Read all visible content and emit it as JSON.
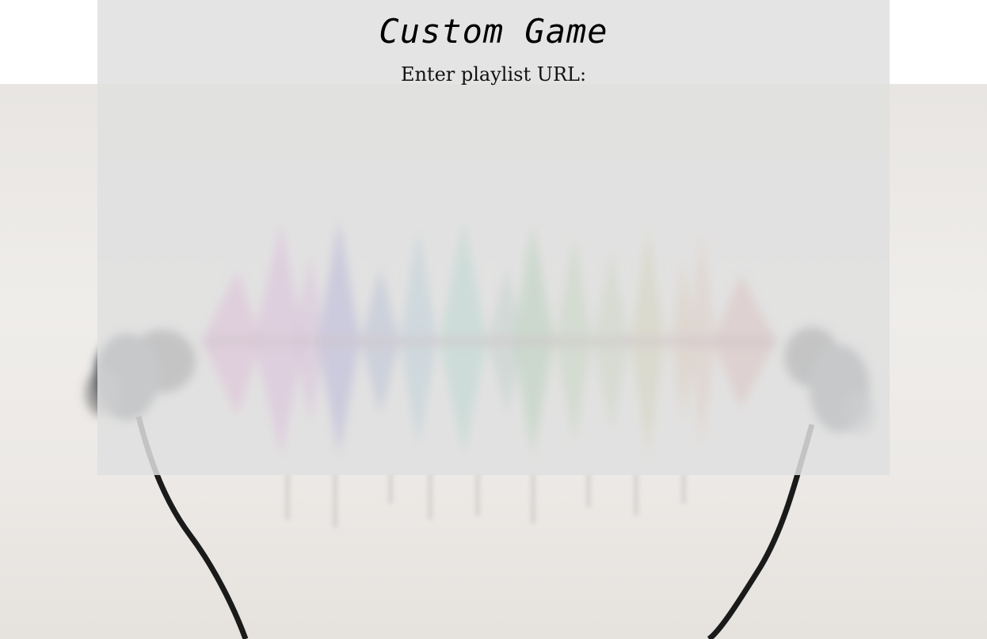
{
  "page": {
    "title": "Custom Game",
    "prompt": "Enter playlist URL:"
  },
  "background": {
    "image": "earphones-with-rainbow-sound-wave",
    "wave_colors": [
      "#d63fb7",
      "#b537c9",
      "#3b32c4",
      "#2c8fb8",
      "#2fb79a",
      "#2f9a3c",
      "#5aa63a",
      "#a8a23a",
      "#c8863d",
      "#c53b3b"
    ]
  }
}
